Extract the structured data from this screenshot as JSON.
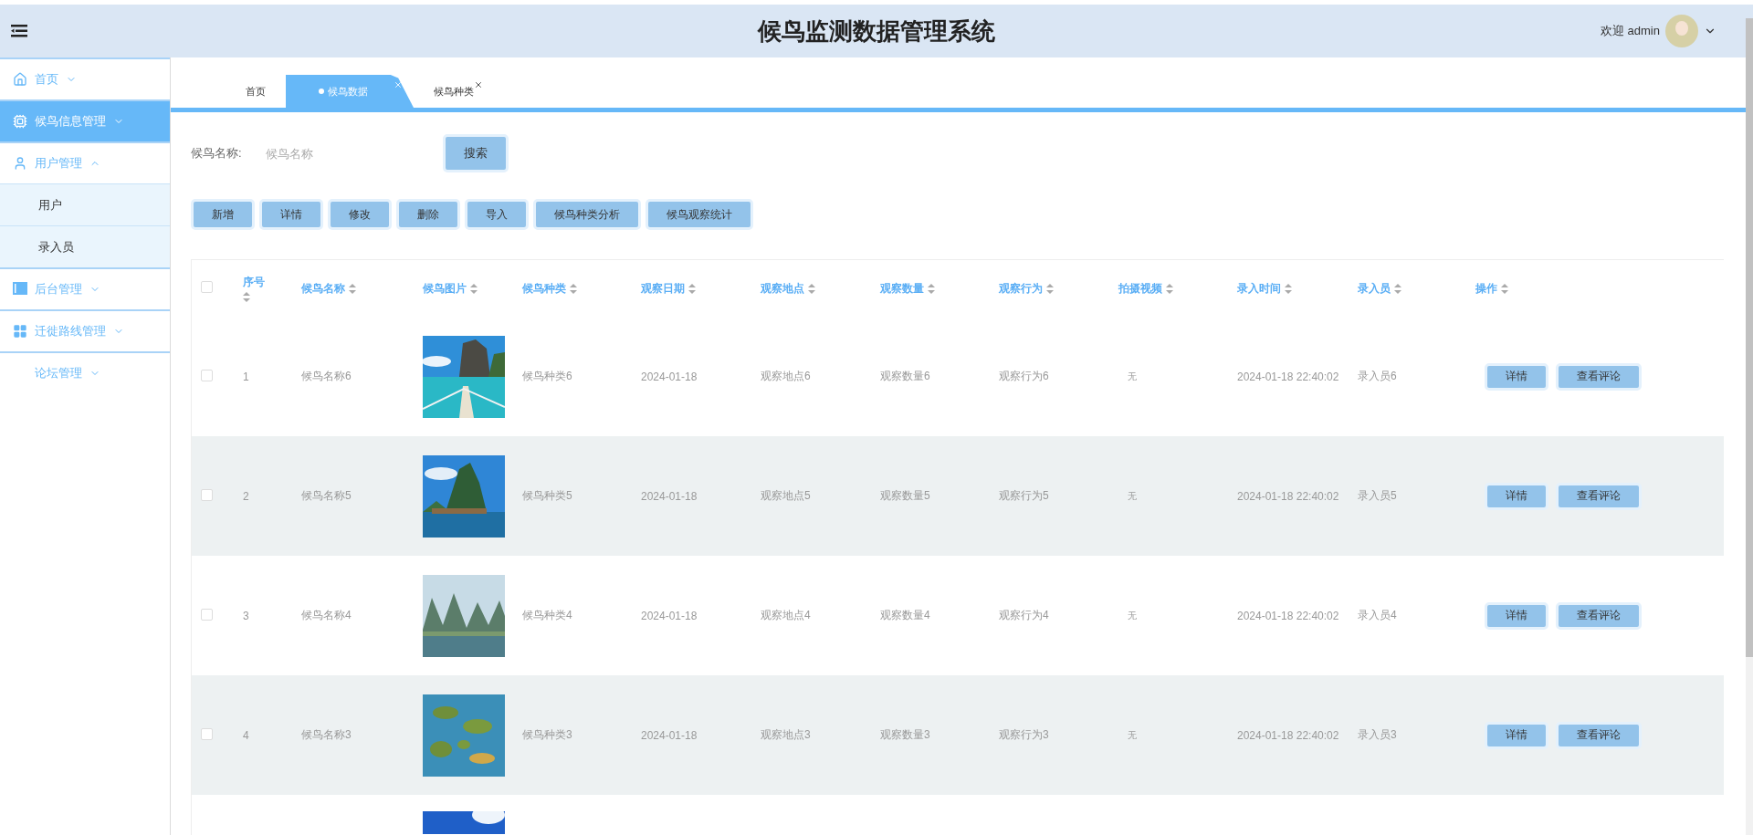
{
  "header": {
    "title": "候鸟监测数据管理系统",
    "welcome": "欢迎 admin"
  },
  "sidebar": {
    "items": [
      {
        "label": "首页",
        "selected": false,
        "expanded": false
      },
      {
        "label": "候鸟信息管理",
        "selected": true,
        "expanded": false
      },
      {
        "label": "用户管理",
        "selected": false,
        "expanded": true,
        "children": [
          {
            "label": "用户",
            "selected": false
          },
          {
            "label": "录入员",
            "selected": false
          }
        ]
      },
      {
        "label": "后台管理",
        "selected": false,
        "expanded": false
      },
      {
        "label": "迁徙路线管理",
        "selected": false,
        "expanded": false
      },
      {
        "label": "论坛管理",
        "selected": false,
        "expanded": false
      }
    ]
  },
  "tabs": [
    {
      "label": "首页",
      "selected": false,
      "closable": false
    },
    {
      "label": "候鸟数据",
      "selected": true,
      "closable": true
    },
    {
      "label": "候鸟种类",
      "selected": false,
      "closable": true
    }
  ],
  "search": {
    "label": "候鸟名称:",
    "placeholder": "候鸟名称",
    "button": "搜索"
  },
  "actions": [
    "新增",
    "详情",
    "修改",
    "删除",
    "导入",
    "候鸟种类分析",
    "候鸟观察统计"
  ],
  "table": {
    "select_all": {
      "checked": false
    },
    "columns": [
      "序号",
      "候鸟名称",
      "候鸟图片",
      "候鸟种类",
      "观察日期",
      "观察地点",
      "观察数量",
      "观察行为",
      "拍摄视频",
      "录入时间",
      "录入员",
      "操作"
    ],
    "rows": [
      {
        "checked": false,
        "index": "1",
        "name": "候鸟名称6",
        "image": {
          "kind": "picture"
        },
        "species": "候鸟种类6",
        "date": "2024-01-18",
        "place": "观察地点6",
        "count": "观察数量6",
        "behavior": "观察行为6",
        "video": "无",
        "created": "2024-01-18 22:40:02",
        "recorder": "录入员6",
        "buttons": [
          "详情",
          "查看评论"
        ]
      },
      {
        "checked": false,
        "index": "2",
        "name": "候鸟名称5",
        "image": {
          "kind": "picture"
        },
        "species": "候鸟种类5",
        "date": "2024-01-18",
        "place": "观察地点5",
        "count": "观察数量5",
        "behavior": "观察行为5",
        "video": "无",
        "created": "2024-01-18 22:40:02",
        "recorder": "录入员5",
        "buttons": [
          "详情",
          "查看评论"
        ]
      },
      {
        "checked": false,
        "index": "3",
        "name": "候鸟名称4",
        "image": {
          "kind": "picture"
        },
        "species": "候鸟种类4",
        "date": "2024-01-18",
        "place": "观察地点4",
        "count": "观察数量4",
        "behavior": "观察行为4",
        "video": "无",
        "created": "2024-01-18 22:40:02",
        "recorder": "录入员4",
        "buttons": [
          "详情",
          "查看评论"
        ]
      },
      {
        "checked": false,
        "index": "4",
        "name": "候鸟名称3",
        "image": {
          "kind": "picture"
        },
        "species": "候鸟种类3",
        "date": "2024-01-18",
        "place": "观察地点3",
        "count": "观察数量3",
        "behavior": "观察行为3",
        "video": "无",
        "created": "2024-01-18 22:40:02",
        "recorder": "录入员3",
        "buttons": [
          "详情",
          "查看评论"
        ]
      },
      {
        "image": {
          "kind": "picture"
        }
      }
    ]
  }
}
